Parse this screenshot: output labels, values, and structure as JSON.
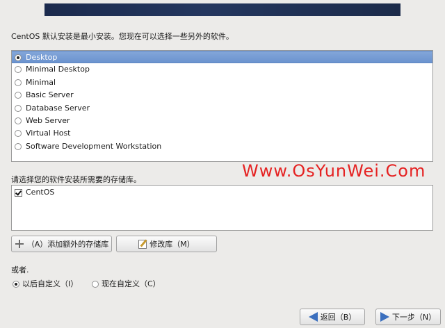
{
  "intro_text": "CentOS 默认安装是最小安装。您现在可以选择一些另外的软件。",
  "package_groups": [
    {
      "label": "Desktop",
      "selected": true
    },
    {
      "label": "Minimal Desktop",
      "selected": false
    },
    {
      "label": "Minimal",
      "selected": false
    },
    {
      "label": "Basic Server",
      "selected": false
    },
    {
      "label": "Database Server",
      "selected": false
    },
    {
      "label": "Web Server",
      "selected": false
    },
    {
      "label": "Virtual Host",
      "selected": false
    },
    {
      "label": "Software Development Workstation",
      "selected": false
    }
  ],
  "watermark": "Www.OsYunWei.Com",
  "repo_label": "请选择您的软件安装所需要的存储库。",
  "repos": [
    {
      "label": "CentOS",
      "checked": true
    }
  ],
  "buttons": {
    "add_repo": "（A）添加额外的存储库",
    "modify_repo": "修改库（M）",
    "back": "返回（B）",
    "next": "下一步（N）"
  },
  "customize": {
    "or_label": "或者.",
    "later": "以后自定义（I）",
    "now": "现在自定义（C）",
    "selected": "later"
  },
  "icons": {
    "add": "plus-icon",
    "modify": "edit-icon",
    "back": "arrow-left-icon",
    "next": "arrow-right-icon"
  },
  "colors": {
    "selection": "#7aa0d6",
    "watermark": "#e52222",
    "banner": "#1f2f52",
    "arrow": "#3b6fbe"
  }
}
